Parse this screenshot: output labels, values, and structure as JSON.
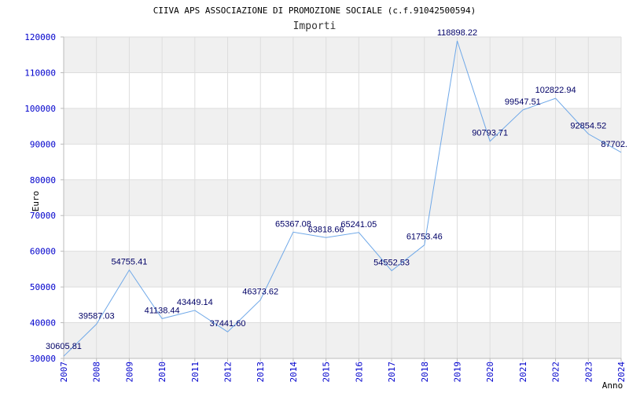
{
  "chart_data": {
    "type": "line",
    "title": "CIIVA APS ASSOCIAZIONE DI PROMOZIONE SOCIALE (c.f.91042500594)",
    "subtitle": "Importi",
    "xlabel": "Anno",
    "ylabel": "Euro",
    "ylim": [
      30000,
      120000
    ],
    "y_ticks": [
      "30000",
      "40000",
      "50000",
      "60000",
      "70000",
      "80000",
      "90000",
      "100000",
      "110000",
      "120000"
    ],
    "categories": [
      "2007",
      "2008",
      "2009",
      "2010",
      "2011",
      "2012",
      "2013",
      "2014",
      "2015",
      "2016",
      "2017",
      "2018",
      "2019",
      "2020",
      "2021",
      "2022",
      "2023",
      "2024"
    ],
    "values": [
      30605.81,
      39587.03,
      54755.41,
      41138.44,
      43449.14,
      37441.6,
      46373.62,
      65367.08,
      63818.66,
      65241.05,
      54552.53,
      61753.46,
      118898.22,
      90793.71,
      99547.51,
      102822.94,
      92854.52,
      87702.5
    ],
    "value_labels": [
      "30605.81",
      "39587.03",
      "54755.41",
      "41138.44",
      "43449.14",
      "37441.60",
      "46373.62",
      "65367.08",
      "63818.66",
      "65241.05",
      "54552.53",
      "61753.46",
      "118898.22",
      "90793.71",
      "99547.51",
      "102822.94",
      "92854.52",
      "87702."
    ],
    "grid": true,
    "banded_background": true,
    "legend": "none",
    "colors": {
      "line": "#6fa8e8",
      "tick_text": "#0000cc",
      "data_label": "#000066",
      "band": "#f0f0f0",
      "grid": "#dddddd",
      "axis": "#bbbbbb",
      "title": "#000000"
    }
  }
}
